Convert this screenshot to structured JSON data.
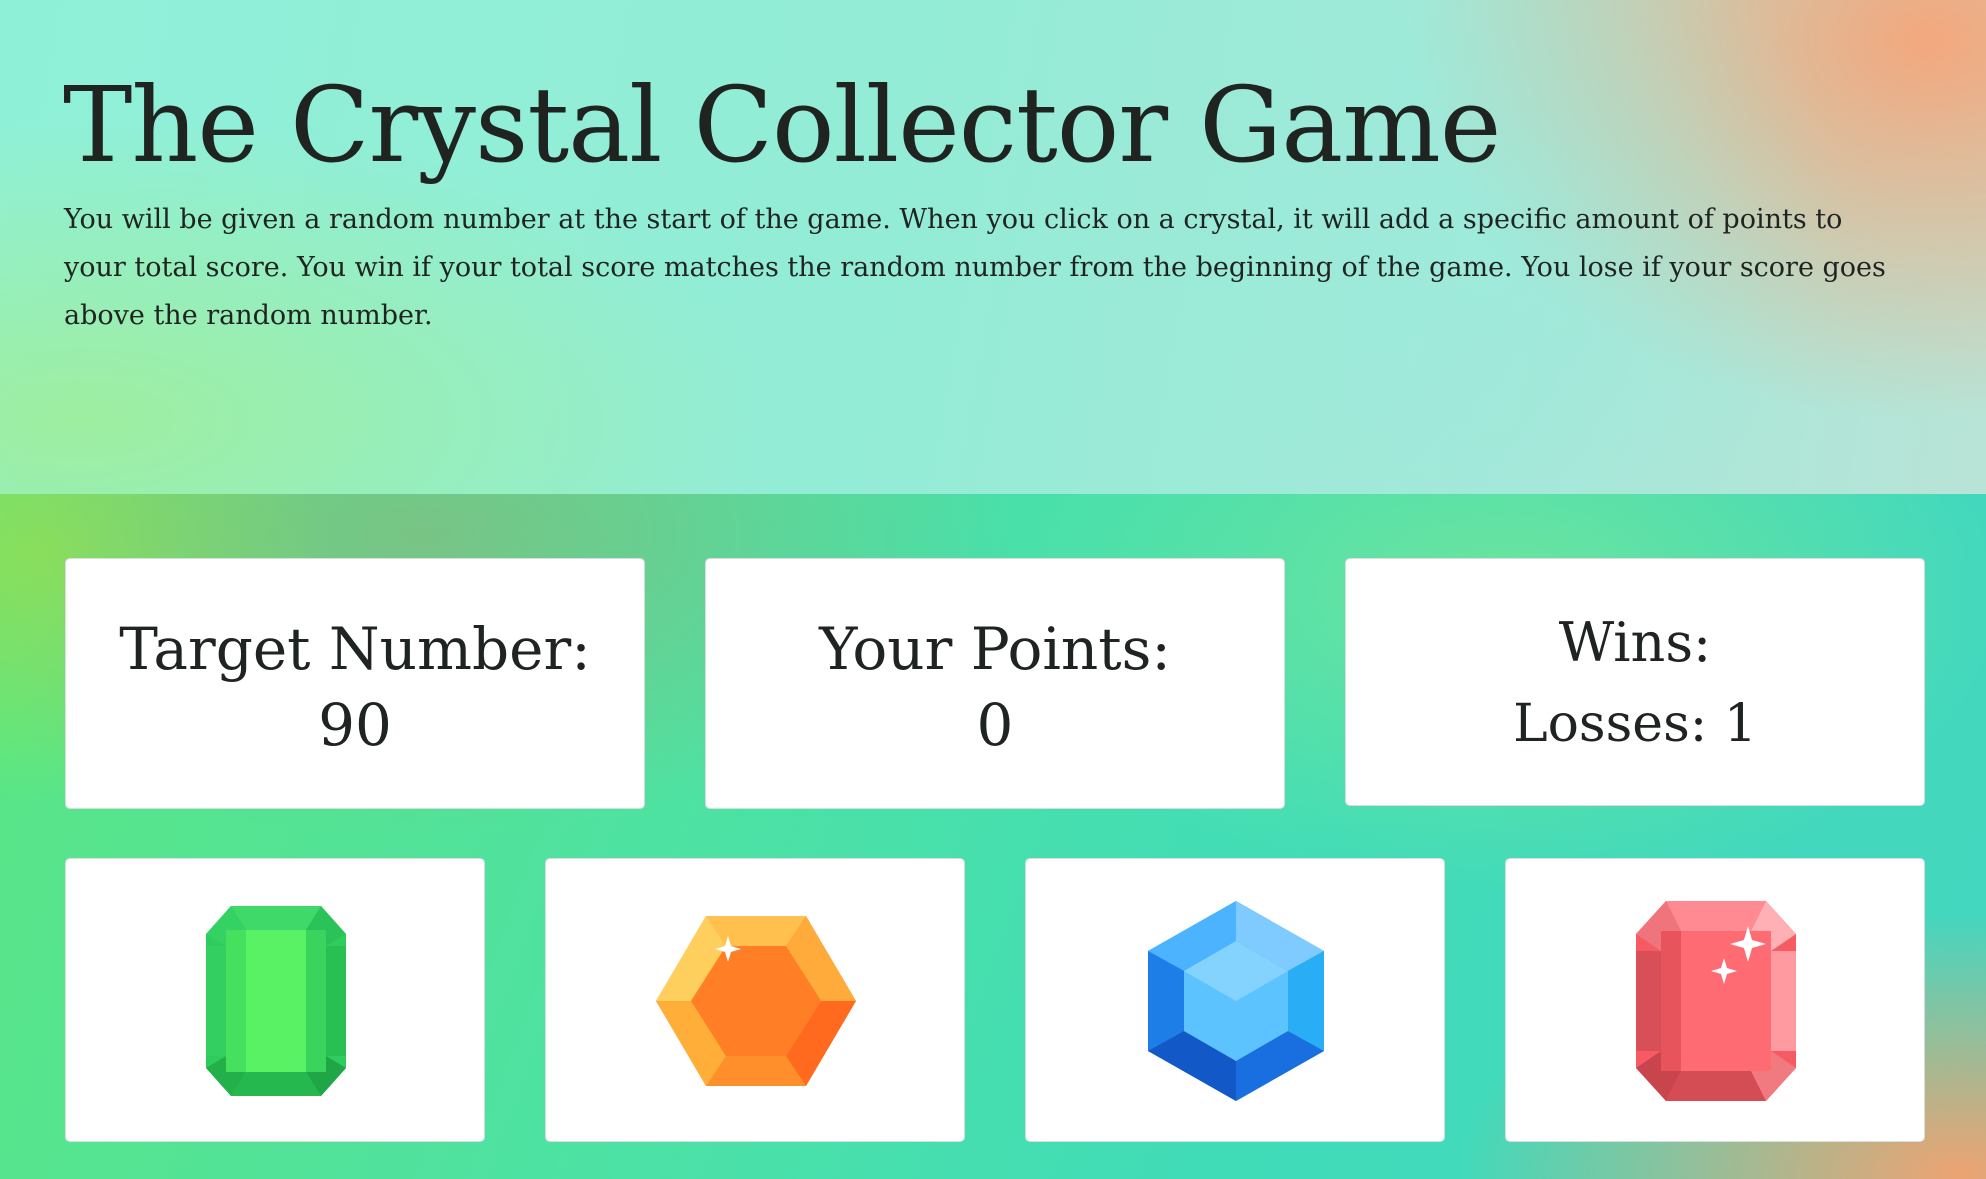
{
  "header": {
    "title": "The Crystal Collector Game",
    "instructions": "You will be given a random number at the start of the game. When you click on a crystal, it will add a specific amount of points to your total score. You win if your total score matches the random number from the beginning of the game. You lose if your score goes above the random number."
  },
  "stats": {
    "target_label": "Target Number:",
    "target_value": "90",
    "points_label": "Your Points:",
    "points_value": "0",
    "wins_label": "Wins:",
    "wins_value": "",
    "losses_label": "Losses:",
    "losses_value": "1"
  },
  "crystals": [
    {
      "name": "green-crystal",
      "icon": "emerald-gem-icon",
      "color": "#3dd661"
    },
    {
      "name": "orange-crystal",
      "icon": "hexagon-gem-icon",
      "color": "#ff7e26"
    },
    {
      "name": "blue-crystal",
      "icon": "sapphire-gem-icon",
      "color": "#2aa8f2"
    },
    {
      "name": "red-crystal",
      "icon": "ruby-gem-icon",
      "color": "#f65b63"
    }
  ],
  "colors": {
    "header_bg": "#93ecd6",
    "board_bg": "#4ee2a2",
    "card_bg": "#ffffff",
    "text": "#1f2421"
  }
}
